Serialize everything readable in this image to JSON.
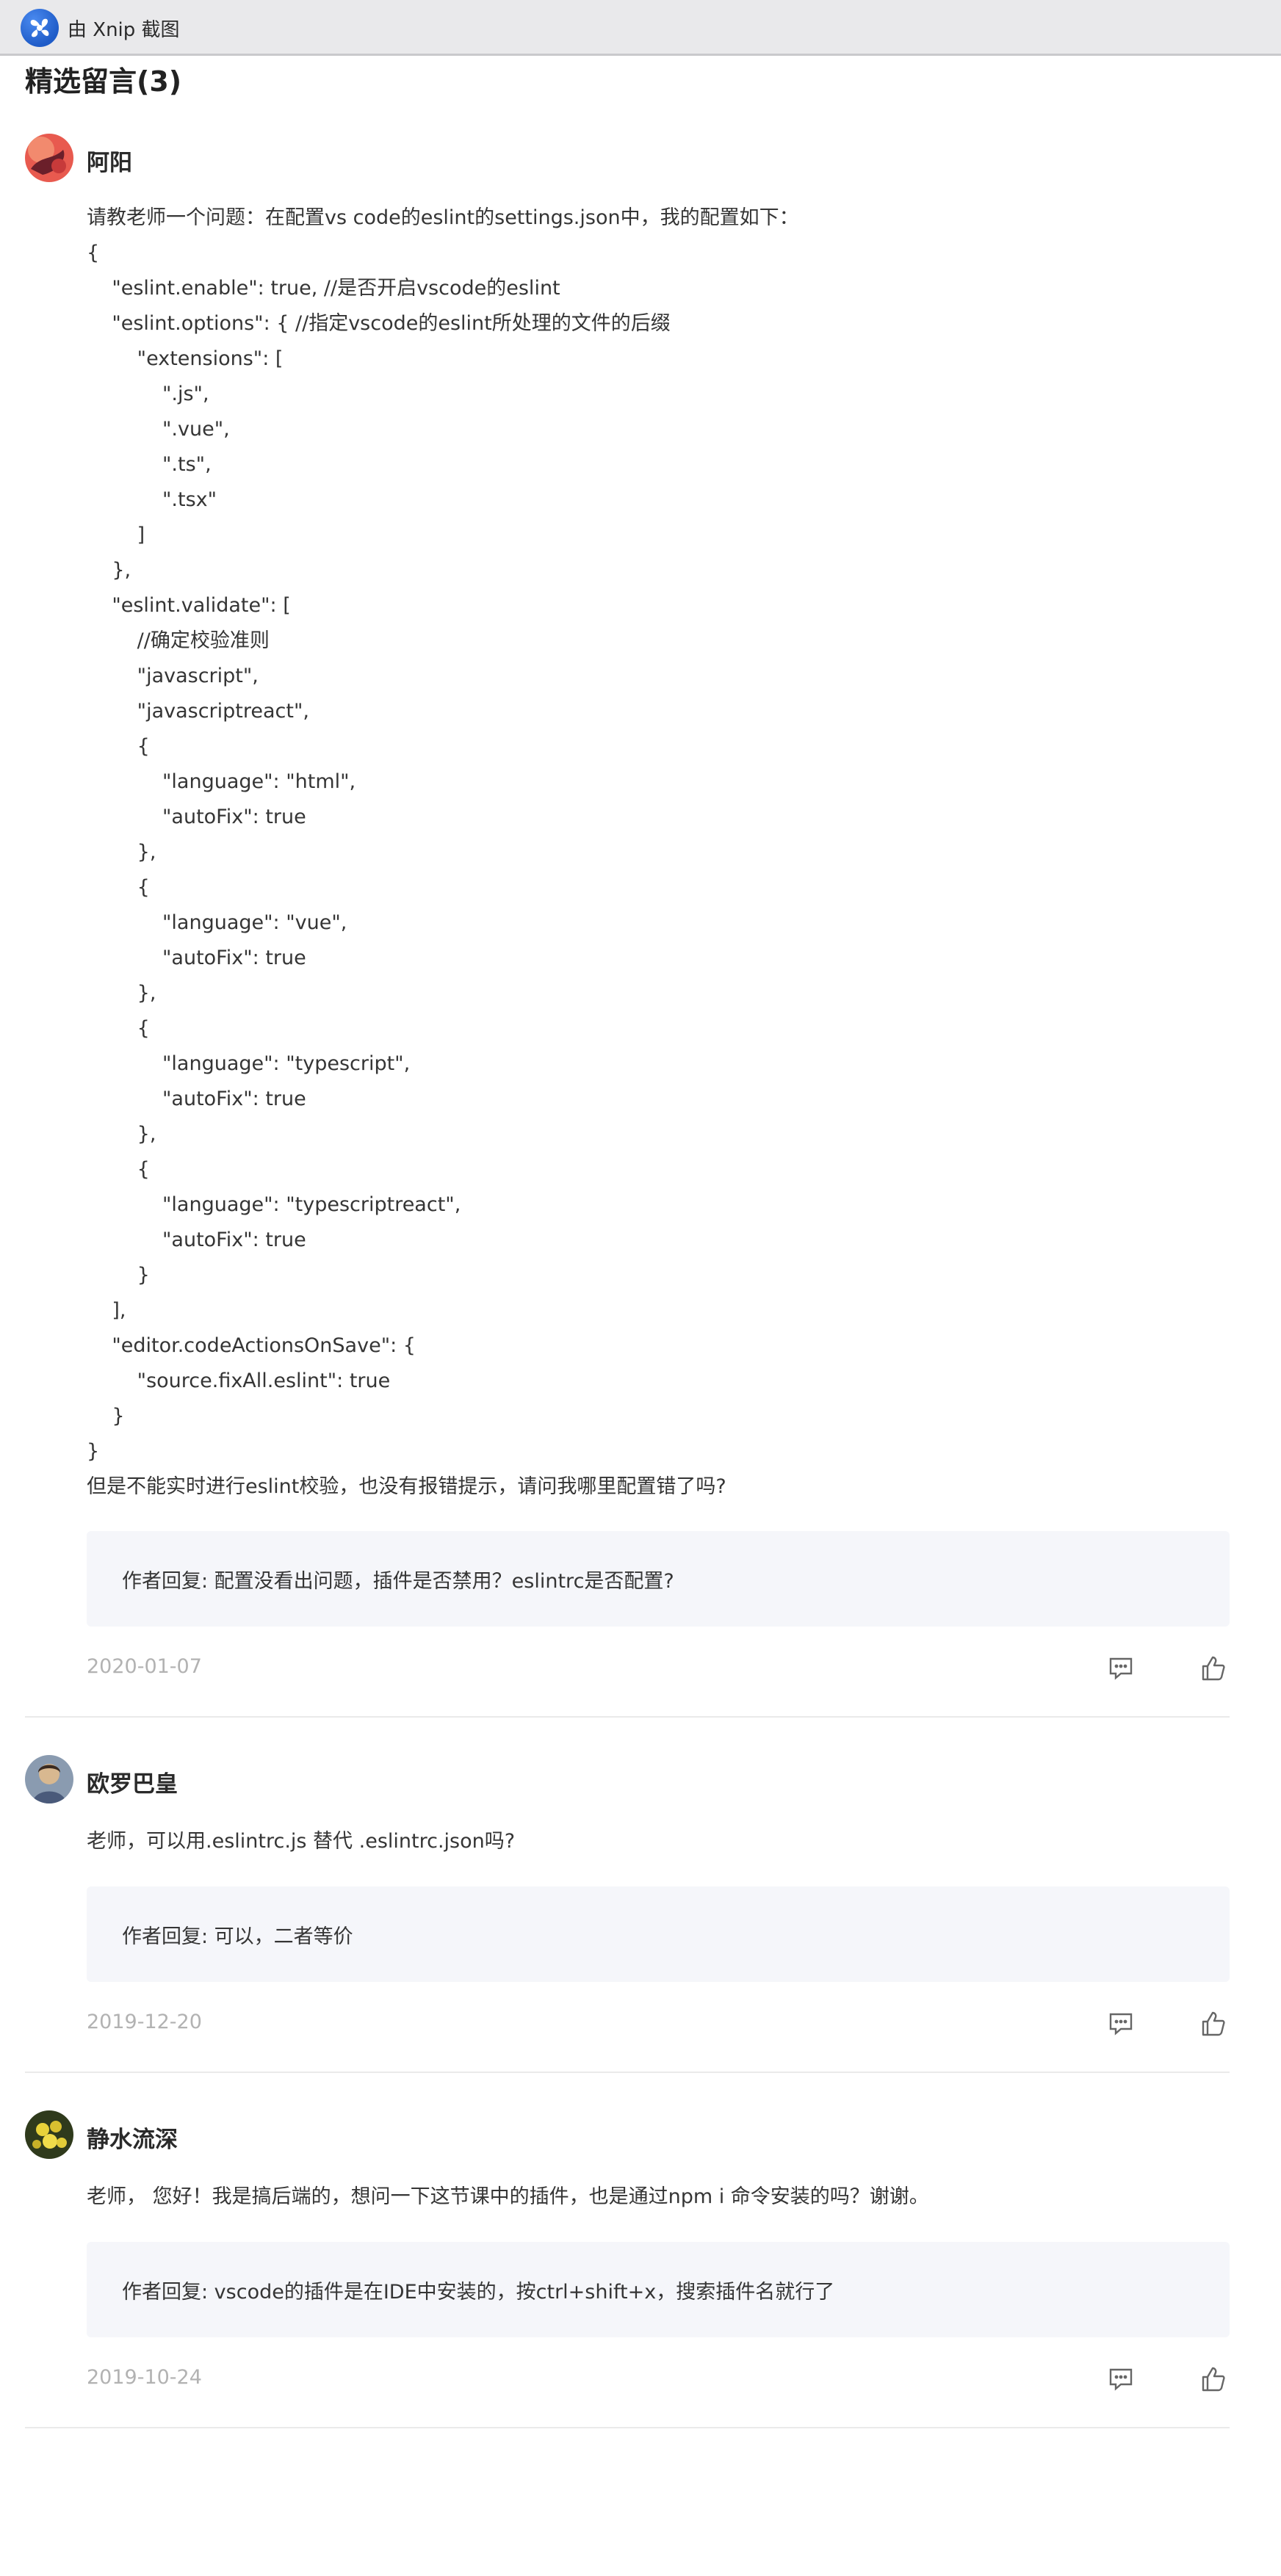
{
  "window": {
    "title": "由 Xnip 截图"
  },
  "section": {
    "title": "精选留言(3)"
  },
  "comments": [
    {
      "username": "阿阳",
      "content": "请教老师一个问题：在配置vs code的eslint的settings.json中，我的配置如下：\n{\n    \"eslint.enable\": true, //是否开启vscode的eslint\n    \"eslint.options\": { //指定vscode的eslint所处理的文件的后缀\n        \"extensions\": [\n            \".js\",\n            \".vue\",\n            \".ts\",\n            \".tsx\"\n        ]\n    },\n    \"eslint.validate\": [\n        //确定校验准则\n        \"javascript\",\n        \"javascriptreact\",\n        {\n            \"language\": \"html\",\n            \"autoFix\": true\n        },\n        {\n            \"language\": \"vue\",\n            \"autoFix\": true\n        },\n        {\n            \"language\": \"typescript\",\n            \"autoFix\": true\n        },\n        {\n            \"language\": \"typescriptreact\",\n            \"autoFix\": true\n        }\n    ],\n    \"editor.codeActionsOnSave\": {\n        \"source.fixAll.eslint\": true\n    }\n}\n但是不能实时进行eslint校验，也没有报错提示，请问我哪里配置错了吗?",
      "reply": "作者回复: 配置没看出问题，插件是否禁用？eslintrc是否配置?",
      "date": "2020-01-07",
      "avatar_icon": "avatar-red-icon"
    },
    {
      "username": "欧罗巴皇",
      "content": "老师，可以用.eslintrc.js 替代 .eslintrc.json吗?",
      "reply": "作者回复: 可以，二者等价",
      "date": "2019-12-20",
      "avatar_icon": "avatar-portrait-icon"
    },
    {
      "username": "静水流深",
      "content": "老师， 您好！我是搞后端的，想问一下这节课中的插件，也是通过npm i 命令安装的吗？谢谢。",
      "reply": "作者回复: vscode的插件是在IDE中安装的，按ctrl+shift+x，搜索插件名就行了",
      "date": "2019-10-24",
      "avatar_icon": "avatar-flower-icon"
    }
  ],
  "icons": {
    "comment": "comment-icon",
    "like": "thumbs-up-icon",
    "logo": "xnip-logo-icon"
  },
  "colors": {
    "date": "#b2b2b2",
    "reply_bg": "#f5f6fa",
    "topbar_bg": "#e9e9eb"
  }
}
